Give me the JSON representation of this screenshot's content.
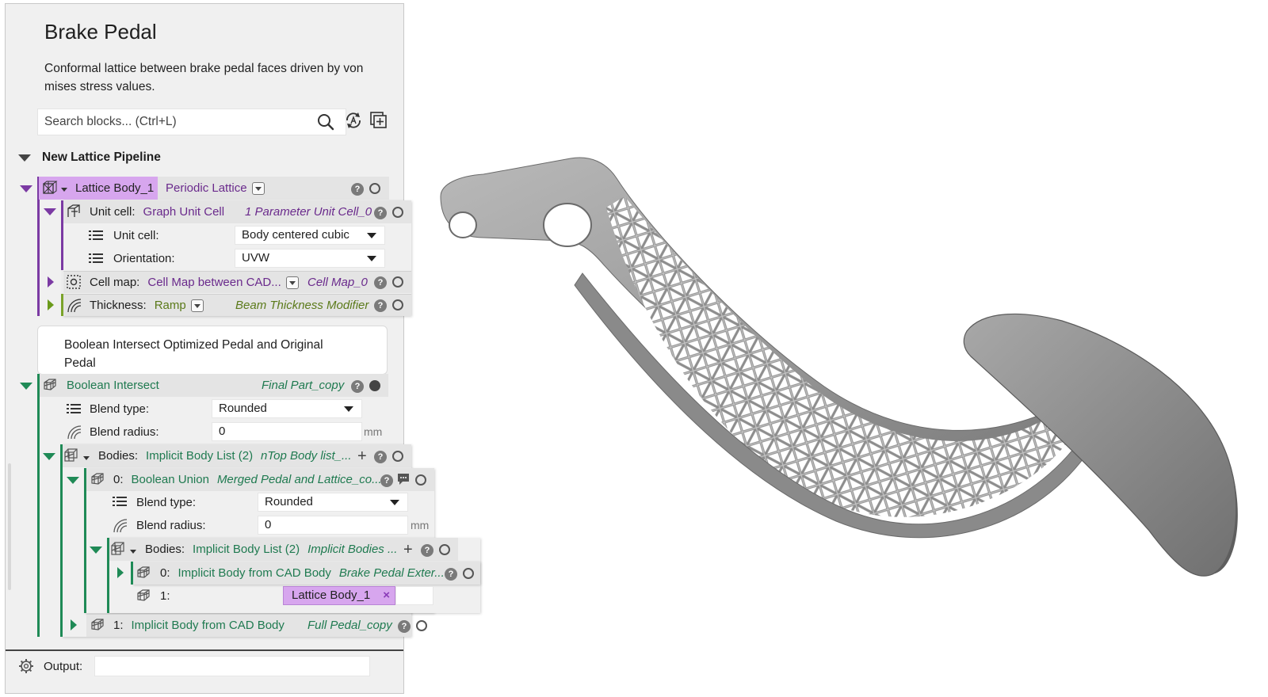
{
  "panel": {
    "title": "Brake Pedal",
    "description": "Conformal lattice between brake pedal faces driven by  von mises stress values.",
    "search_placeholder": "Search blocks... (Ctrl+L)"
  },
  "pipeline": {
    "label": "New Lattice Pipeline"
  },
  "lattice_block": {
    "name": "Lattice Body_1",
    "type": "Periodic Lattice",
    "unit_cell": {
      "label": "Unit cell:",
      "type": "Graph Unit Cell",
      "ref": "1 Parameter Unit Cell_0",
      "params": [
        {
          "label": "Unit cell:",
          "value": "Body centered cubic"
        },
        {
          "label": "Orientation:",
          "value": "UVW"
        }
      ]
    },
    "cell_map": {
      "label": "Cell map:",
      "type": "Cell Map between CAD...",
      "ref": "Cell Map_0"
    },
    "thickness": {
      "label": "Thickness:",
      "type": "Ramp",
      "ref": "Beam Thickness Modifier"
    }
  },
  "note": {
    "text": "Boolean Intersect Optimized Pedal and Original Pedal"
  },
  "boolean_block": {
    "name": "Boolean Intersect",
    "ref": "Final Part_copy",
    "blend_type": {
      "label": "Blend type:",
      "value": "Rounded"
    },
    "blend_radius": {
      "label": "Blend radius:",
      "value": "0",
      "unit": "mm"
    },
    "bodies": {
      "label": "Bodies:",
      "type": "Implicit Body List (2)",
      "ref": "nTop Body list_..."
    },
    "union": {
      "index": "0:",
      "name": "Boolean Union",
      "ref": "Merged Pedal and Lattice_co...",
      "blend_type": {
        "label": "Blend type:",
        "value": "Rounded"
      },
      "blend_radius": {
        "label": "Blend radius:",
        "value": "0",
        "unit": "mm"
      },
      "bodies": {
        "label": "Bodies:",
        "type": "Implicit Body List (2)",
        "ref": "Implicit Bodies ..."
      },
      "item0": {
        "index": "0:",
        "name": "Implicit Body from CAD Body",
        "ref": "Brake Pedal Exter..."
      },
      "item1": {
        "index": "1:",
        "chip": "Lattice Body_1"
      }
    },
    "item1": {
      "index": "1:",
      "name": "Implicit Body from CAD Body",
      "ref": "Full Pedal_copy"
    }
  },
  "output": {
    "label": "Output:"
  },
  "help_glyph": "?",
  "remove_glyph": "×",
  "colors": {
    "lattice_purple": "#6a2a8c",
    "lattice_header": "#d7a6ee",
    "boolean_green": "#1f7a50",
    "thickness_olive": "#5b7a1a",
    "part_gray": "#9a9a9a"
  }
}
